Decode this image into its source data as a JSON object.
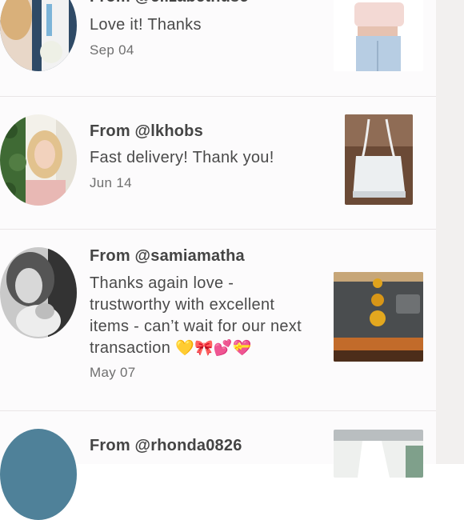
{
  "reviews": [
    {
      "from": "From @elizabethusc",
      "message": "Love it! Thanks",
      "date": "Sep 04",
      "avatar_icon": "user-photo-avatar",
      "thumb_icon": "item-photo-top"
    },
    {
      "from": "From @lkhobs",
      "message": "Fast delivery! Thank you!",
      "date": "Jun 14",
      "avatar_icon": "user-photo-avatar",
      "thumb_icon": "item-photo-tote-bag"
    },
    {
      "from": "From @samiamatha",
      "message": "Thanks again love - trustworthy with excellent items - can’t wait for our next transaction",
      "emoji": "💛🎀💕💝",
      "date": "May 07",
      "avatar_icon": "user-photo-avatar",
      "thumb_icon": "item-photo-earrings"
    },
    {
      "from": "From @rhonda0826",
      "avatar_icon": "user-photo-avatar",
      "thumb_icon": "item-photo-clothing"
    }
  ],
  "colors": {
    "list_bg": "#fcfbfc",
    "right_pane_bg": "#f2f0ef",
    "divider": "#e9e5e6",
    "text_primary": "#4a4a4a",
    "text_secondary": "#6f6f6f"
  }
}
